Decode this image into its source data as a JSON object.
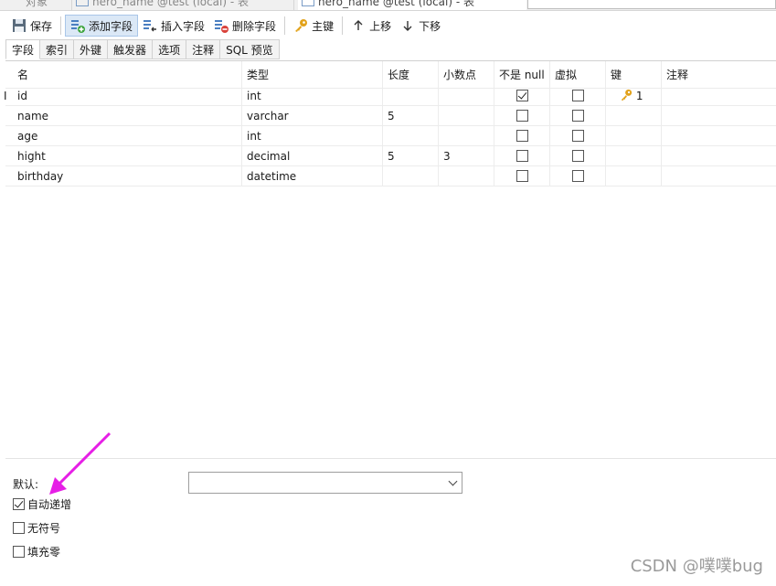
{
  "doc_tabs": {
    "tab1": "对象",
    "tab2": "hero_name @test (local) - 表",
    "tab3": "hero_name @test (local) - 表"
  },
  "toolbar": {
    "save": "保存",
    "add_field": "添加字段",
    "insert_field": "插入字段",
    "delete_field": "删除字段",
    "primary_key": "主键",
    "move_up": "上移",
    "move_down": "下移"
  },
  "subtabs": [
    "字段",
    "索引",
    "外键",
    "触发器",
    "选项",
    "注释",
    "SQL 预览"
  ],
  "columns": {
    "name": "名",
    "type": "类型",
    "length": "长度",
    "decimals": "小数点",
    "not_null": "不是 null",
    "virtual": "虚拟",
    "key": "键",
    "comment": "注释"
  },
  "rows": [
    {
      "name": "id",
      "type": "int",
      "length": "",
      "decimals": "",
      "not_null": true,
      "virtual": false,
      "key": "1"
    },
    {
      "name": "name",
      "type": "varchar",
      "length": "5",
      "decimals": "",
      "not_null": false,
      "virtual": false,
      "key": ""
    },
    {
      "name": "age",
      "type": "int",
      "length": "",
      "decimals": "",
      "not_null": false,
      "virtual": false,
      "key": ""
    },
    {
      "name": "hight",
      "type": "decimal",
      "length": "5",
      "decimals": "3",
      "not_null": false,
      "virtual": false,
      "key": ""
    },
    {
      "name": "birthday",
      "type": "datetime",
      "length": "",
      "decimals": "",
      "not_null": false,
      "virtual": false,
      "key": ""
    }
  ],
  "props": {
    "default_label": "默认:",
    "default_value": "",
    "auto_increment": "自动递增",
    "auto_increment_checked": true,
    "unsigned": "无符号",
    "unsigned_checked": false,
    "zerofill": "填充零",
    "zerofill_checked": false
  },
  "annotation_color": "#e61ee6",
  "watermark": "CSDN @噗噗bug"
}
